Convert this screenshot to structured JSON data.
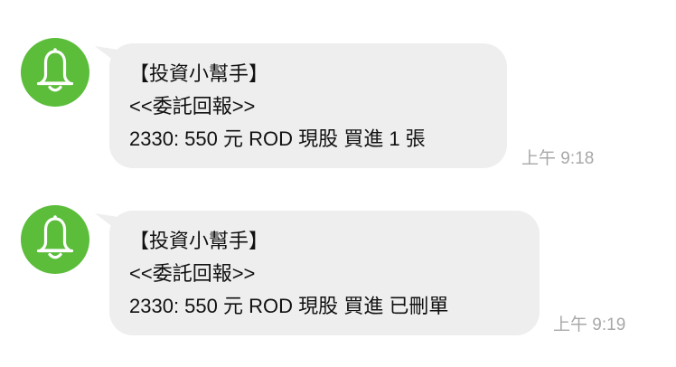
{
  "messages": [
    {
      "avatar_icon": "bell-icon",
      "lines": [
        "【投資小幫手】",
        "<<委託回報>>",
        "2330: 550 元 ROD 現股 買進 1 張"
      ],
      "time": "上午 9:18"
    },
    {
      "avatar_icon": "bell-icon",
      "lines": [
        "【投資小幫手】",
        "<<委託回報>>",
        "2330: 550 元 ROD 現股 買進 已刪單"
      ],
      "time": "上午 9:19"
    }
  ],
  "colors": {
    "avatar_bg": "#5bbd3a",
    "bubble_bg": "#eeeeee",
    "timestamp": "#a8a8a8"
  }
}
